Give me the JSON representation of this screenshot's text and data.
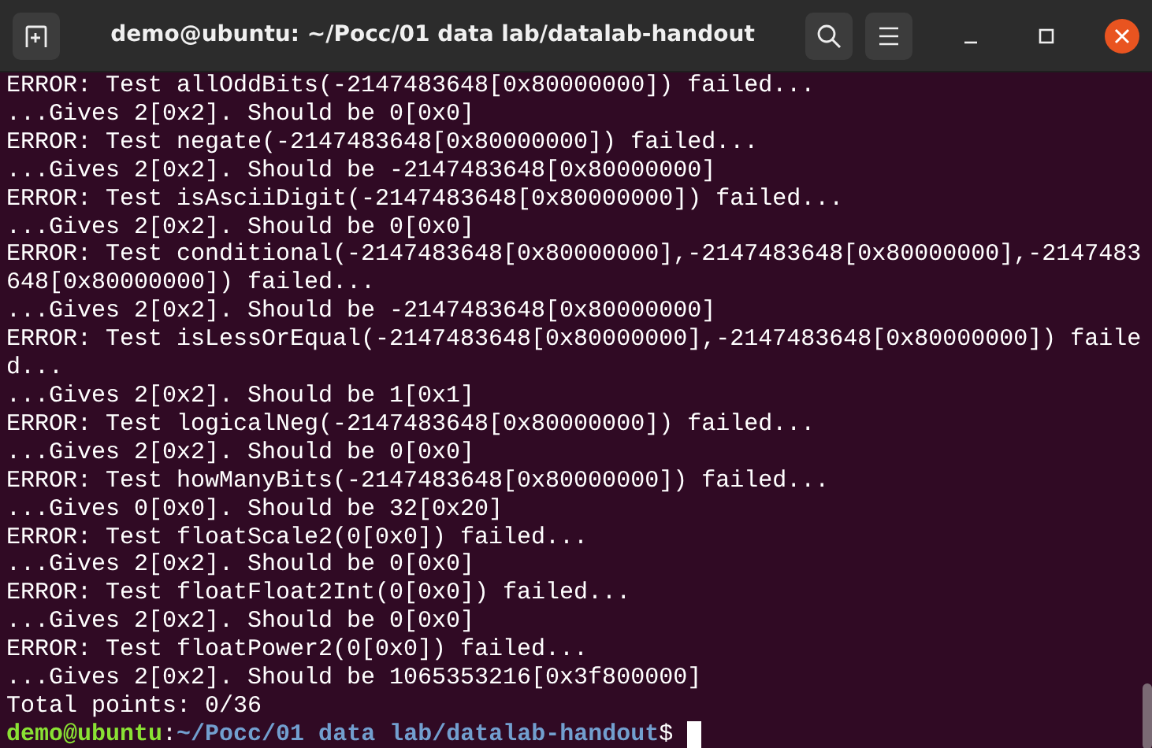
{
  "window": {
    "title": "demo@ubuntu: ~/Pocc/01 data lab/datalab-handout"
  },
  "terminal": {
    "lines": [
      "ERROR: Test allOddBits(-2147483648[0x80000000]) failed...",
      "...Gives 2[0x2]. Should be 0[0x0]",
      "ERROR: Test negate(-2147483648[0x80000000]) failed...",
      "...Gives 2[0x2]. Should be -2147483648[0x80000000]",
      "ERROR: Test isAsciiDigit(-2147483648[0x80000000]) failed...",
      "...Gives 2[0x2]. Should be 0[0x0]",
      "ERROR: Test conditional(-2147483648[0x80000000],-2147483648[0x80000000],-2147483",
      "648[0x80000000]) failed...",
      "...Gives 2[0x2]. Should be -2147483648[0x80000000]",
      "ERROR: Test isLessOrEqual(-2147483648[0x80000000],-2147483648[0x80000000]) faile",
      "d...",
      "...Gives 2[0x2]. Should be 1[0x1]",
      "ERROR: Test logicalNeg(-2147483648[0x80000000]) failed...",
      "...Gives 2[0x2]. Should be 0[0x0]",
      "ERROR: Test howManyBits(-2147483648[0x80000000]) failed...",
      "...Gives 0[0x0]. Should be 32[0x20]",
      "ERROR: Test floatScale2(0[0x0]) failed...",
      "...Gives 2[0x2]. Should be 0[0x0]",
      "ERROR: Test floatFloat2Int(0[0x0]) failed...",
      "...Gives 2[0x2]. Should be 0[0x0]",
      "ERROR: Test floatPower2(0[0x0]) failed...",
      "...Gives 2[0x2]. Should be 1065353216[0x3f800000]",
      "Total points: 0/36"
    ],
    "prompt": {
      "user_host": "demo@ubuntu",
      "separator": ":",
      "path": "~/Pocc/01 data lab/datalab-handout",
      "symbol": "$"
    }
  }
}
